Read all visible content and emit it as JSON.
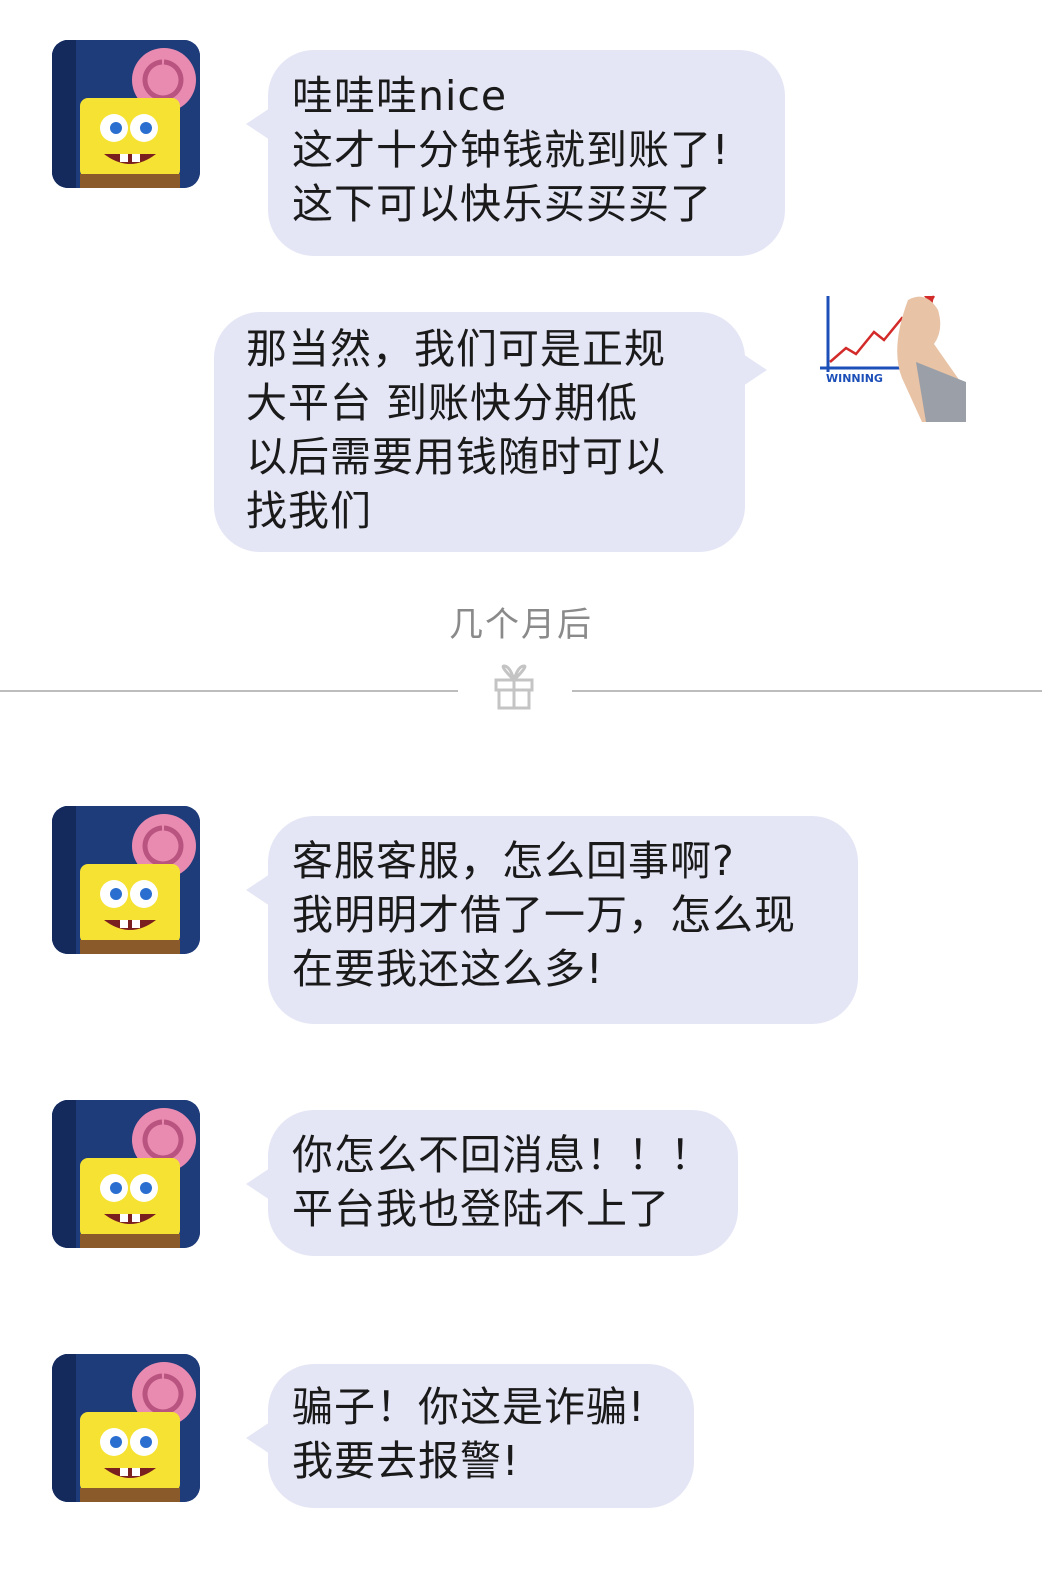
{
  "messages": [
    {
      "side": "left",
      "sender": "user",
      "text": "哇哇哇nice\n这才十分钟钱就到账了!\n这下可以快乐买买买了"
    },
    {
      "side": "right",
      "sender": "service",
      "text": "那当然，我们可是正规\n大平台 到账快分期低\n以后需要用钱随时可以\n找我们"
    },
    {
      "side": "left",
      "sender": "user",
      "text": "客服客服，怎么回事啊?\n我明明才借了一万，怎么现\n在要我还这么多!"
    },
    {
      "side": "left",
      "sender": "user",
      "text": "你怎么不回消息！！！\n平台我也登陆不上了"
    },
    {
      "side": "left",
      "sender": "user",
      "text": "骗子！你这是诈骗!\n我要去报警!"
    }
  ],
  "divider": {
    "label": "几个月后",
    "icon": "gift-icon"
  },
  "service_avatar": {
    "caption": "WINNING"
  },
  "user_avatar": {
    "icon": "spongebob-avatar"
  },
  "colors": {
    "bubble": "#e4e6f6",
    "divider": "#bdbdbd",
    "label": "#8a8a8a"
  }
}
